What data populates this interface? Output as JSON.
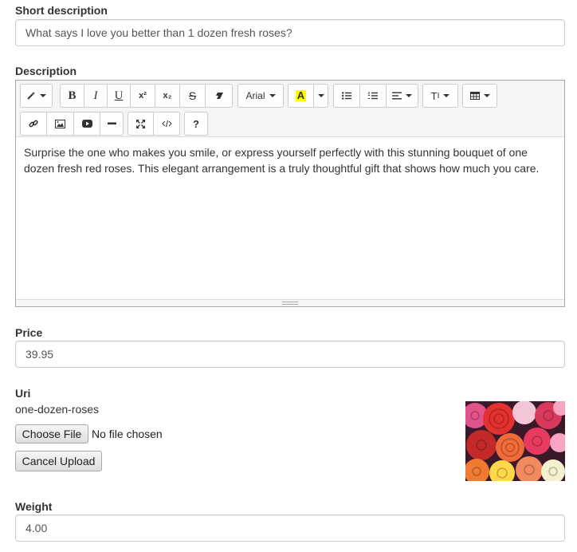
{
  "short_description": {
    "label": "Short description",
    "value": "What says I love you better than 1 dozen fresh roses?"
  },
  "description": {
    "label": "Description",
    "toolbar": {
      "font_name": "Arial",
      "highlight_letter": "A",
      "style_label": "T",
      "help_label": "?",
      "highlight_color": "#ffff00"
    },
    "content": "Surprise the one who makes you smile, or express yourself perfectly with this stunning bouquet of one dozen fresh red roses. This elegant arrangement is a truly thoughtful gift that shows how much you care."
  },
  "price": {
    "label": "Price",
    "value": "39.95"
  },
  "uri": {
    "label": "Uri",
    "value": "one-dozen-roses",
    "choose_file_label": "Choose File",
    "no_file_text": "No file chosen",
    "cancel_upload_label": "Cancel Upload"
  },
  "weight": {
    "label": "Weight",
    "value": "4.00"
  }
}
